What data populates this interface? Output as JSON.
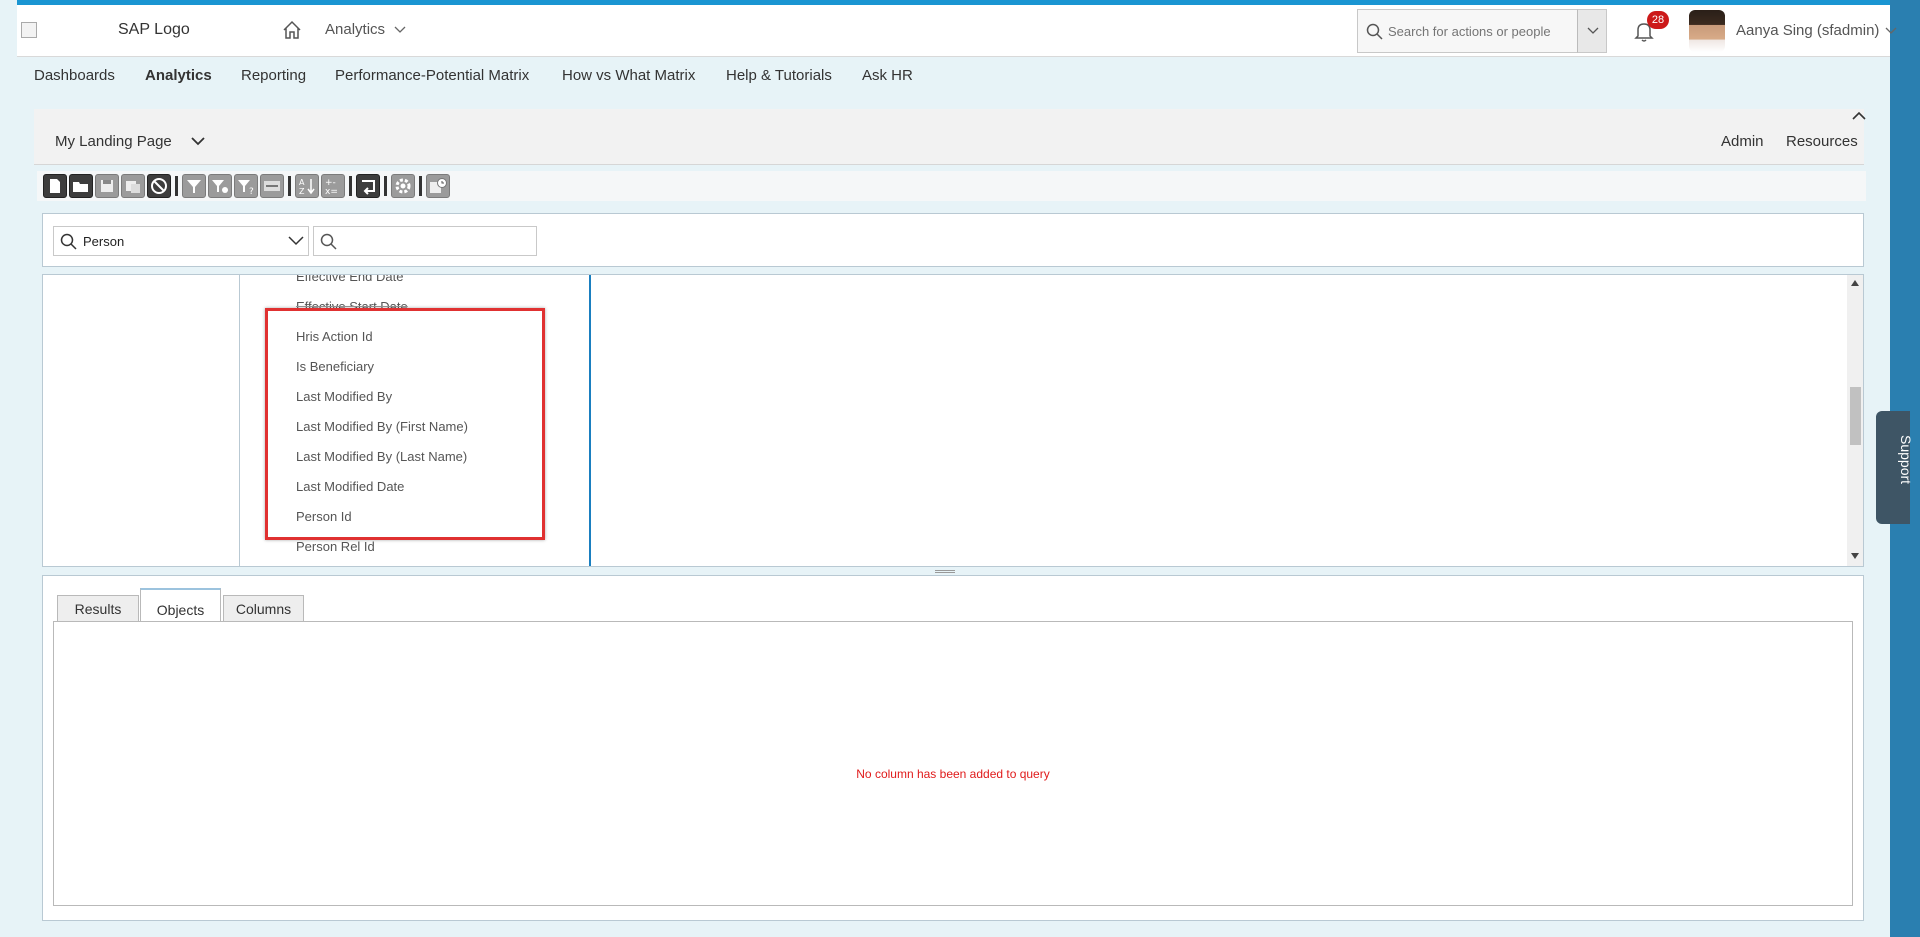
{
  "header": {
    "logo_alt": "SAP Logo",
    "module": "Analytics",
    "search_placeholder": "Search for actions or people",
    "notification_count": "28",
    "user_name": "Aanya Sing (sfadmin)"
  },
  "nav": {
    "items": [
      {
        "label": "Dashboards"
      },
      {
        "label": "Analytics"
      },
      {
        "label": "Reporting"
      },
      {
        "label": "Performance-Potential Matrix"
      },
      {
        "label": "How vs What Matrix"
      },
      {
        "label": "Help & Tutorials"
      },
      {
        "label": "Ask HR"
      }
    ],
    "active": "Analytics"
  },
  "landing": {
    "title": "My Landing Page",
    "admin": "Admin",
    "resources": "Resources"
  },
  "query": {
    "source_value": "Person",
    "field_search_value": ""
  },
  "fields": [
    "Effective End Date",
    "Effective Start Date",
    "Hris Action Id",
    "Is Beneficiary",
    "Last Modified By",
    "Last Modified By (First Name)",
    "Last Modified By (Last Name)",
    "Last Modified Date",
    "Person Id",
    "Person Rel Id"
  ],
  "results": {
    "tabs": [
      "Results",
      "Objects",
      "Columns"
    ],
    "active_tab": "Objects",
    "empty_message": "No column has been added to query"
  },
  "support": {
    "label": "Support"
  },
  "colors": {
    "accent": "#1a95d2",
    "nav_bg": "#e7f3f7",
    "highlight": "#e03131",
    "error_text": "#e01b1b"
  }
}
